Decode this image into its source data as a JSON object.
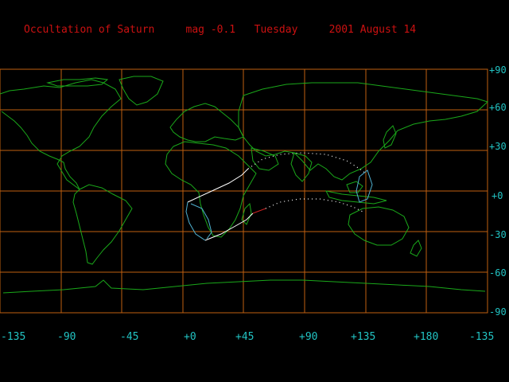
{
  "header": {
    "event": "Occultation of Saturn",
    "magnitude": "mag -0.1",
    "weekday": "Tuesday",
    "date": "2001 August 14"
  },
  "lat_labels": [
    "+90",
    "+60",
    "+30",
    "+0",
    "-30",
    "-60",
    "-90"
  ],
  "lon_labels": [
    "-135",
    "-90",
    "-45",
    "+0",
    "+45",
    "+90",
    "+135",
    "+180",
    "-135"
  ],
  "colors": {
    "background": "#000000",
    "title": "#cc1111",
    "grid": "#c06010",
    "coast": "#1aa81a",
    "labels": "#22c3c3",
    "path_visible": "#ffffff",
    "path_limit": "#4fb0d0",
    "path_day": "#cc2222"
  }
}
